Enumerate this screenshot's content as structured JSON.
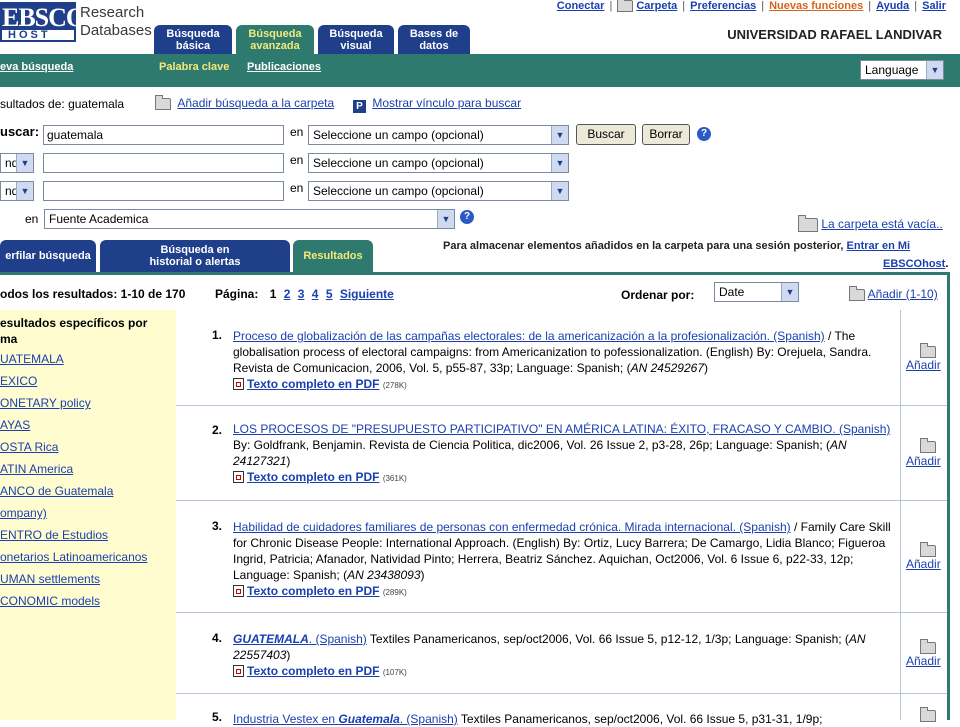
{
  "logo": {
    "text_top": "EBSCO",
    "text_bottom": "HOST",
    "brand_color": "#1f3f8a"
  },
  "brand": {
    "line1": "Research",
    "line2": "Databases"
  },
  "main_tabs": [
    {
      "line1": "Búsqueda",
      "line2": "básica"
    },
    {
      "line1": "Búsqueda",
      "line2": "avanzada"
    },
    {
      "line1": "Búsqueda",
      "line2": "visual"
    },
    {
      "line1": "Bases de",
      "line2": "datos"
    }
  ],
  "top_links": {
    "conectar": "Conectar",
    "carpeta": "Carpeta",
    "preferencias": "Preferencias",
    "nuevas": "Nuevas funciones",
    "ayuda": "Ayuda",
    "salir": "Salir"
  },
  "institution": "UNIVERSIDAD RAFAEL LANDIVAR",
  "navbar": {
    "nueva": "eva búsqueda",
    "palabra": "Palabra clave",
    "publicaciones": "Publicaciones",
    "language": "Language",
    "accent": "#2e7a6e",
    "highlight": "#f4e97a"
  },
  "search": {
    "results_label": "sultados de:",
    "results_term": "guatemala",
    "add_to_folder": "Añadir búsqueda a la carpeta",
    "show_link": "Mostrar vínculo para buscar",
    "buscar_label": "uscar:",
    "query": "guatemala",
    "en": "en",
    "field_placeholder": "Seleccione un campo (opcional)",
    "bool1": "nd",
    "bool2": "nd",
    "buscar_btn": "Buscar",
    "borrar_btn": "Borrar",
    "source_en": "en",
    "source_value": "Fuente Academica",
    "folder_empty": "La carpeta está vacía..",
    "store_text": "Para almacenar elementos añadidos en la carpeta para una sesión posterior,",
    "store_link": "Entrar en Mi",
    "store_link2": "EBSCOhost",
    "store_end": "."
  },
  "result_tabs": [
    {
      "line1": "erfilar búsqueda",
      "line2": ""
    },
    {
      "line1": "Búsqueda en",
      "line2": "historial o alertas"
    },
    {
      "line1": "Resultados",
      "line2": ""
    }
  ],
  "results_bar": {
    "summary": "odos los resultados: 1-10 de 170",
    "page_label": "Página:",
    "current_page": "1",
    "pages": [
      "2",
      "3",
      "4",
      "5"
    ],
    "next": "Siguiente",
    "sort_label": "Ordenar por:",
    "sort_value": "Date",
    "add_range": "Añadir (1-10)"
  },
  "facets": {
    "heading1": "esultados específicos por",
    "heading2": "ma",
    "items": [
      "UATEMALA",
      "EXICO",
      "ONETARY policy",
      "AYAS",
      "OSTA Rica",
      "ATIN America",
      "ANCO de Guatemala",
      "ompany)",
      "ENTRO de Estudios",
      "onetarios Latinoamericanos",
      "UMAN settlements",
      "CONOMIC models"
    ]
  },
  "results": [
    {
      "num": "1.",
      "title": "Proceso de globalización de las campañas electorales: de la americanización a la profesionalización. (Spanish)",
      "rest": " / The globalisation process of electoral campaigns: from Americanization to pofessionalization. (English) By: Orejuela, Sandra. Revista de Comunicacion, 2006, Vol. 5, p55-87, 33p; Language: Spanish; (",
      "an_label": "AN",
      "an": " 24529267",
      "close": ")",
      "pdf": "Texto completo en PDF",
      "size": "(278K)",
      "add": "Añadir"
    },
    {
      "num": "2.",
      "title": "LOS PROCESOS DE \"PRESUPUESTO PARTICIPATIVO\" EN AMÉRICA LATINA: ÉXITO, FRACASO Y CAMBIO. (Spanish)",
      "rest": " By: Goldfrank, Benjamin. Revista de Ciencia Politica, dic2006, Vol. 26 Issue 2, p3-28, 26p; Language: Spanish; (",
      "an_label": "AN",
      "an": " 24127321",
      "close": ")",
      "pdf": "Texto completo en PDF",
      "size": "(361K)",
      "add": "Añadir"
    },
    {
      "num": "3.",
      "title": "Habilidad de cuidadores familiares de personas con enfermedad crónica. Mirada internacional. (Spanish)",
      "rest": " / Family Care Skill for Chronic Disease People: International Approach. (English) By: Ortiz, Lucy Barrera; De Camargo, Lidia Blanco; Figueroa Ingrid, Patricia; Afanador, Natividad Pinto; Herrera, Beatriz Sánchez. Aquichan, Oct2006, Vol. 6 Issue 6, p22-33, 12p; Language: Spanish; (",
      "an_label": "AN",
      "an": " 23438093",
      "close": ")",
      "pdf": "Texto completo en PDF",
      "size": "(289K)",
      "add": "Añadir"
    },
    {
      "num": "4.",
      "title_em": "GUATEMALA",
      "title": ". (Spanish)",
      "rest": " Textiles Panamericanos, sep/oct2006, Vol. 66 Issue 5, p12-12, 1/3p; Language: Spanish; (",
      "an_label": "AN",
      "an": " 22557403",
      "close": ")",
      "pdf": "Texto completo en PDF",
      "size": "(107K)",
      "add": "Añadir"
    },
    {
      "num": "5.",
      "title_pre": "Industria Vestex en ",
      "title_em": "Guatemala",
      "title": ". (Spanish)",
      "rest": " Textiles Panamericanos, sep/oct2006, Vol. 66 Issue 5, p31-31, 1/9p;"
    }
  ]
}
